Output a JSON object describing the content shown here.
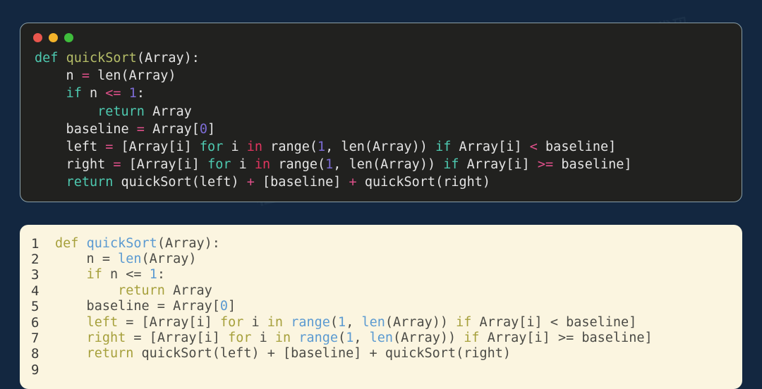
{
  "background": {
    "color": "#132740"
  },
  "watermarks": [
    {
      "text": "数据"
    },
    {
      "text": "程序员"
    },
    {
      "text": "算法"
    },
    {
      "text": "代码"
    }
  ],
  "dark_window": {
    "name": "dark-code-window",
    "background": "#21211f",
    "border_color": "#8ba0a8",
    "traffic_lights": [
      {
        "name": "close",
        "color": "#e9564d"
      },
      {
        "name": "minimize",
        "color": "#f3b32a"
      },
      {
        "name": "zoom",
        "color": "#3fbd3c"
      }
    ],
    "language": "python",
    "code_plain": "def quickSort(Array):\n    n = len(Array)\n    if n <= 1:\n        return Array\n    baseline = Array[0]\n    left = [Array[i] for i in range(1, len(Array)) if Array[i] < baseline]\n    right = [Array[i] for i in range(1, len(Array)) if Array[i] >= baseline]\n    return quickSort(left) + [baseline] + quickSort(right)",
    "lines": [
      [
        {
          "t": "def",
          "c": "d-kw"
        },
        {
          "t": " ",
          "c": "d-plain"
        },
        {
          "t": "quickSort",
          "c": "d-fn"
        },
        {
          "t": "(Array):",
          "c": "d-plain"
        }
      ],
      [
        {
          "t": "    n ",
          "c": "d-plain"
        },
        {
          "t": "=",
          "c": "d-op"
        },
        {
          "t": " len(Array)",
          "c": "d-plain"
        }
      ],
      [
        {
          "t": "    ",
          "c": "d-plain"
        },
        {
          "t": "if",
          "c": "d-kw"
        },
        {
          "t": " n ",
          "c": "d-plain"
        },
        {
          "t": "<=",
          "c": "d-op"
        },
        {
          "t": " ",
          "c": "d-plain"
        },
        {
          "t": "1",
          "c": "d-num"
        },
        {
          "t": ":",
          "c": "d-plain"
        }
      ],
      [
        {
          "t": "        ",
          "c": "d-plain"
        },
        {
          "t": "return",
          "c": "d-kw"
        },
        {
          "t": " Array",
          "c": "d-plain"
        }
      ],
      [
        {
          "t": "    baseline ",
          "c": "d-plain"
        },
        {
          "t": "=",
          "c": "d-op"
        },
        {
          "t": " Array[",
          "c": "d-plain"
        },
        {
          "t": "0",
          "c": "d-num"
        },
        {
          "t": "]",
          "c": "d-plain"
        }
      ],
      [
        {
          "t": "    left ",
          "c": "d-plain"
        },
        {
          "t": "=",
          "c": "d-op"
        },
        {
          "t": " [Array[i] ",
          "c": "d-plain"
        },
        {
          "t": "for",
          "c": "d-kw"
        },
        {
          "t": " i ",
          "c": "d-plain"
        },
        {
          "t": "in",
          "c": "d-in"
        },
        {
          "t": " range(",
          "c": "d-plain"
        },
        {
          "t": "1",
          "c": "d-num"
        },
        {
          "t": ", len(Array)) ",
          "c": "d-plain"
        },
        {
          "t": "if",
          "c": "d-kw"
        },
        {
          "t": " Array[i] ",
          "c": "d-plain"
        },
        {
          "t": "<",
          "c": "d-op"
        },
        {
          "t": " baseline]",
          "c": "d-plain"
        }
      ],
      [
        {
          "t": "    right ",
          "c": "d-plain"
        },
        {
          "t": "=",
          "c": "d-op"
        },
        {
          "t": " [Array[i] ",
          "c": "d-plain"
        },
        {
          "t": "for",
          "c": "d-kw"
        },
        {
          "t": " i ",
          "c": "d-plain"
        },
        {
          "t": "in",
          "c": "d-in"
        },
        {
          "t": " range(",
          "c": "d-plain"
        },
        {
          "t": "1",
          "c": "d-num"
        },
        {
          "t": ", len(Array)) ",
          "c": "d-plain"
        },
        {
          "t": "if",
          "c": "d-kw"
        },
        {
          "t": " Array[i] ",
          "c": "d-plain"
        },
        {
          "t": ">=",
          "c": "d-op"
        },
        {
          "t": " baseline]",
          "c": "d-plain"
        }
      ],
      [
        {
          "t": "    ",
          "c": "d-plain"
        },
        {
          "t": "return",
          "c": "d-kw"
        },
        {
          "t": " quickSort(left) ",
          "c": "d-plain"
        },
        {
          "t": "+",
          "c": "d-op"
        },
        {
          "t": " [baseline] ",
          "c": "d-plain"
        },
        {
          "t": "+",
          "c": "d-op"
        },
        {
          "t": " quickSort(right)",
          "c": "d-plain"
        }
      ]
    ]
  },
  "light_window": {
    "name": "light-code-panel",
    "background": "#fbf5e0",
    "language": "python",
    "line_numbers": [
      "1",
      "2",
      "3",
      "4",
      "5",
      "6",
      "7",
      "8",
      "9"
    ],
    "code_plain": "def quickSort(Array):\n    n = len(Array)\n    if n <= 1:\n        return Array\n    baseline = Array[0]\n    left = [Array[i] for i in range(1, len(Array)) if Array[i] < baseline]\n    right = [Array[i] for i in range(1, len(Array)) if Array[i] >= baseline]\n    return quickSort(left) + [baseline] + quickSort(right)\n",
    "lines": [
      [
        {
          "t": "def",
          "c": "l-kw"
        },
        {
          "t": " ",
          "c": "l-plain"
        },
        {
          "t": "quickSort",
          "c": "l-fn"
        },
        {
          "t": "(Array):",
          "c": "l-plain"
        }
      ],
      [
        {
          "t": "    n ",
          "c": "l-plain"
        },
        {
          "t": "=",
          "c": "l-op"
        },
        {
          "t": " ",
          "c": "l-plain"
        },
        {
          "t": "len",
          "c": "l-fn"
        },
        {
          "t": "(Array)",
          "c": "l-plain"
        }
      ],
      [
        {
          "t": "    ",
          "c": "l-plain"
        },
        {
          "t": "if",
          "c": "l-kw"
        },
        {
          "t": " n ",
          "c": "l-plain"
        },
        {
          "t": "<=",
          "c": "l-op"
        },
        {
          "t": " ",
          "c": "l-plain"
        },
        {
          "t": "1",
          "c": "l-num"
        },
        {
          "t": ":",
          "c": "l-plain"
        }
      ],
      [
        {
          "t": "        ",
          "c": "l-plain"
        },
        {
          "t": "return",
          "c": "l-kw"
        },
        {
          "t": " Array",
          "c": "l-plain"
        }
      ],
      [
        {
          "t": "    baseline ",
          "c": "l-plain"
        },
        {
          "t": "=",
          "c": "l-op"
        },
        {
          "t": " Array[",
          "c": "l-plain"
        },
        {
          "t": "0",
          "c": "l-num"
        },
        {
          "t": "]",
          "c": "l-plain"
        }
      ],
      [
        {
          "t": "    ",
          "c": "l-plain"
        },
        {
          "t": "left",
          "c": "l-kw"
        },
        {
          "t": " ",
          "c": "l-plain"
        },
        {
          "t": "=",
          "c": "l-op"
        },
        {
          "t": " [Array[i] ",
          "c": "l-plain"
        },
        {
          "t": "for",
          "c": "l-kw"
        },
        {
          "t": " i ",
          "c": "l-plain"
        },
        {
          "t": "in",
          "c": "l-kw"
        },
        {
          "t": " ",
          "c": "l-plain"
        },
        {
          "t": "range",
          "c": "l-fn"
        },
        {
          "t": "(",
          "c": "l-plain"
        },
        {
          "t": "1",
          "c": "l-num"
        },
        {
          "t": ", ",
          "c": "l-plain"
        },
        {
          "t": "len",
          "c": "l-fn"
        },
        {
          "t": "(Array)) ",
          "c": "l-plain"
        },
        {
          "t": "if",
          "c": "l-kw"
        },
        {
          "t": " Array[i] ",
          "c": "l-plain"
        },
        {
          "t": "<",
          "c": "l-op"
        },
        {
          "t": " baseline]",
          "c": "l-plain"
        }
      ],
      [
        {
          "t": "    ",
          "c": "l-plain"
        },
        {
          "t": "right",
          "c": "l-kw"
        },
        {
          "t": " ",
          "c": "l-plain"
        },
        {
          "t": "=",
          "c": "l-op"
        },
        {
          "t": " [Array[i] ",
          "c": "l-plain"
        },
        {
          "t": "for",
          "c": "l-kw"
        },
        {
          "t": " i ",
          "c": "l-plain"
        },
        {
          "t": "in",
          "c": "l-kw"
        },
        {
          "t": " ",
          "c": "l-plain"
        },
        {
          "t": "range",
          "c": "l-fn"
        },
        {
          "t": "(",
          "c": "l-plain"
        },
        {
          "t": "1",
          "c": "l-num"
        },
        {
          "t": ", ",
          "c": "l-plain"
        },
        {
          "t": "len",
          "c": "l-fn"
        },
        {
          "t": "(Array)) ",
          "c": "l-plain"
        },
        {
          "t": "if",
          "c": "l-kw"
        },
        {
          "t": " Array[i] ",
          "c": "l-plain"
        },
        {
          "t": ">=",
          "c": "l-op"
        },
        {
          "t": " baseline]",
          "c": "l-plain"
        }
      ],
      [
        {
          "t": "    ",
          "c": "l-plain"
        },
        {
          "t": "return",
          "c": "l-kw"
        },
        {
          "t": " quickSort(left) ",
          "c": "l-plain"
        },
        {
          "t": "+",
          "c": "l-op"
        },
        {
          "t": " [baseline] ",
          "c": "l-plain"
        },
        {
          "t": "+",
          "c": "l-op"
        },
        {
          "t": " quickSort(right)",
          "c": "l-plain"
        }
      ],
      []
    ]
  }
}
